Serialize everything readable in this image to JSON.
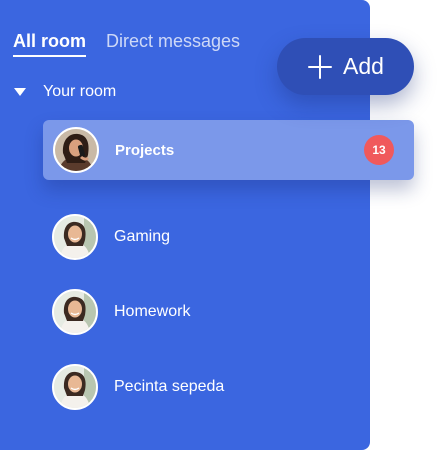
{
  "tabs": [
    {
      "label": "All room",
      "active": true
    },
    {
      "label": "Direct messages",
      "active": false
    }
  ],
  "section": {
    "label": "Your room",
    "icon": "caret-down-icon"
  },
  "add_button": {
    "label": "Add",
    "icon": "plus-icon"
  },
  "active_room": {
    "label": "Projects",
    "unread_count": "13"
  },
  "rooms": [
    {
      "label": "Gaming"
    },
    {
      "label": "Homework"
    },
    {
      "label": "Pecinta sepeda"
    }
  ],
  "colors": {
    "panel_bg": "#3b66e0",
    "active_row_bg": "#7b98ea",
    "badge_bg": "#f0595c",
    "add_button_bg": "#2f4fb6"
  }
}
